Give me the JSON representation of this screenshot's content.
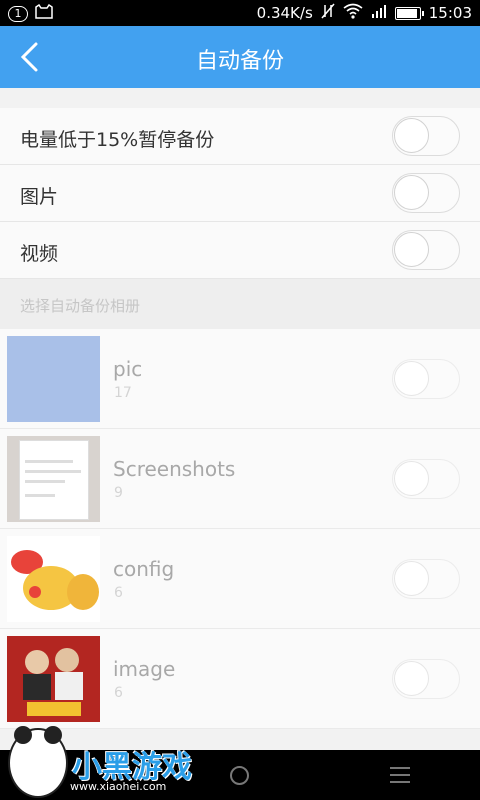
{
  "status_bar": {
    "notification_count": "1",
    "network_speed": "0.34K/s",
    "time": "15:03"
  },
  "header": {
    "title": "自动备份"
  },
  "settings": [
    {
      "label": "电量低于15%暂停备份",
      "enabled": false
    },
    {
      "label": "图片",
      "enabled": false
    },
    {
      "label": "视频",
      "enabled": false
    }
  ],
  "albums_section": {
    "title": "选择自动备份相册",
    "albums": [
      {
        "name": "pic",
        "count": "17",
        "enabled": false
      },
      {
        "name": "Screenshots",
        "count": "9",
        "enabled": false
      },
      {
        "name": "config",
        "count": "6",
        "enabled": false
      },
      {
        "name": "image",
        "count": "6",
        "enabled": false
      }
    ]
  },
  "watermark": {
    "logo_text": "小黑游戏",
    "site": "www.xiaohei.com"
  },
  "colors": {
    "app_bar": "#42a1f0",
    "background": "#f2f2f2"
  }
}
